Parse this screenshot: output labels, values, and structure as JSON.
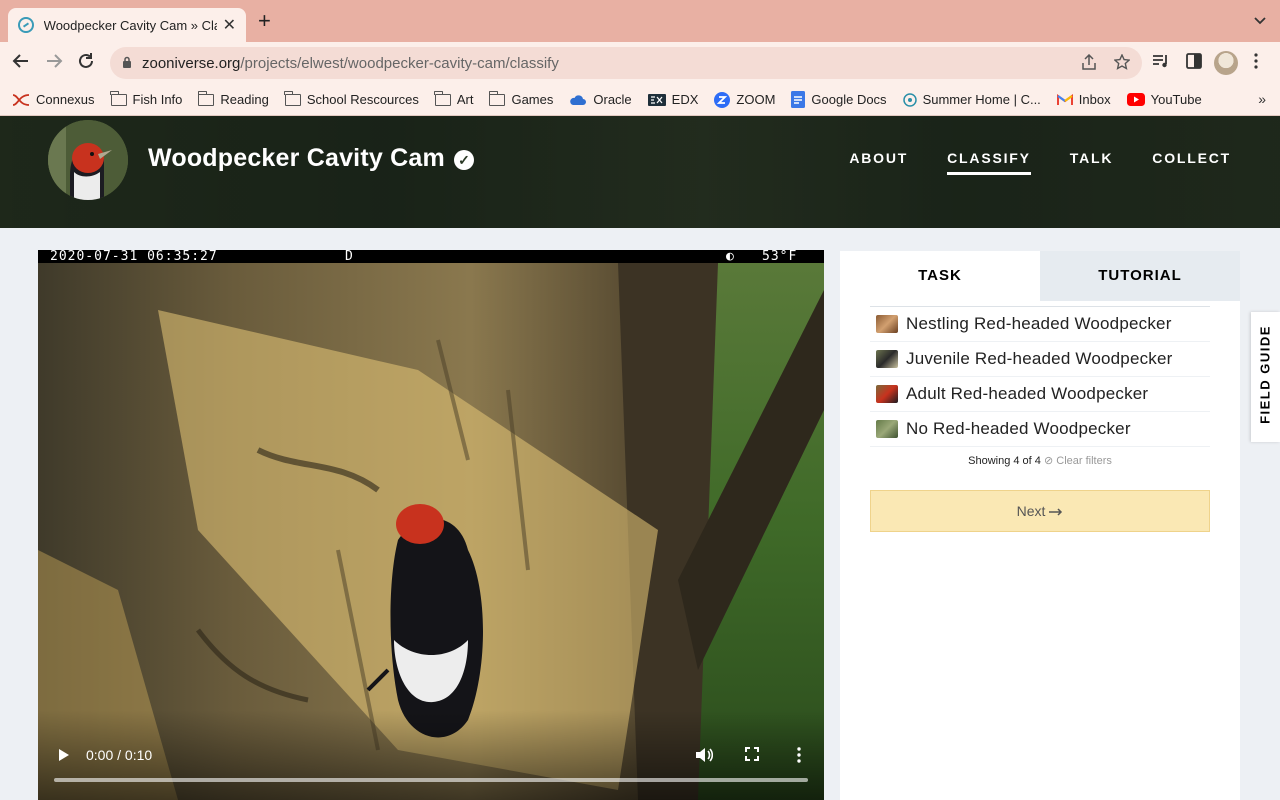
{
  "browser": {
    "tab_title": "Woodpecker Cavity Cam » Classify",
    "tab_close": "✕",
    "new_tab": "+",
    "url_host": "zooniverse.org",
    "url_path": "/projects/elwest/woodpecker-cavity-cam/classify",
    "bookmarks": [
      {
        "label": "Connexus",
        "icon": "connexus-logo"
      },
      {
        "label": "Fish Info",
        "icon": "folder-icon"
      },
      {
        "label": "Reading",
        "icon": "folder-icon"
      },
      {
        "label": "School Rescources",
        "icon": "folder-icon"
      },
      {
        "label": "Art",
        "icon": "folder-icon"
      },
      {
        "label": "Games",
        "icon": "folder-icon"
      },
      {
        "label": "Oracle",
        "icon": "cloud-icon"
      },
      {
        "label": "EDX",
        "icon": "edx-logo"
      },
      {
        "label": "ZOOM",
        "icon": "zoom-logo"
      },
      {
        "label": "Google Docs",
        "icon": "docs-icon"
      },
      {
        "label": "Summer Home | C...",
        "icon": "site-icon"
      },
      {
        "label": "Inbox",
        "icon": "gmail-icon"
      },
      {
        "label": "YouTube",
        "icon": "youtube-icon"
      }
    ],
    "bookmarks_more": "»"
  },
  "site": {
    "project_title": "Woodpecker Cavity Cam",
    "nav": [
      {
        "label": "ABOUT",
        "active": false
      },
      {
        "label": "CLASSIFY",
        "active": true
      },
      {
        "label": "TALK",
        "active": false
      },
      {
        "label": "COLLECT",
        "active": false
      }
    ]
  },
  "video": {
    "timestamp": "2020-07-31 06:35:27",
    "day_flag": "D",
    "moon_glyph": "◐",
    "temperature": "53°F",
    "time_display": "0:00 / 0:10"
  },
  "panel": {
    "tabs": [
      "TASK",
      "TUTORIAL"
    ],
    "answers": [
      {
        "label": "Nestling Red-headed Woodpecker",
        "thumb_color": "#8a5a32"
      },
      {
        "label": "Juvenile Red-headed Woodpecker",
        "thumb_color": "#6d7450"
      },
      {
        "label": "Adult Red-headed Woodpecker",
        "thumb_color": "#7a6a3a"
      },
      {
        "label": "No Red-headed Woodpecker",
        "thumb_color": "#647a48"
      }
    ],
    "showing": "Showing 4 of 4",
    "clear_filters": "Clear filters",
    "next_label": "Next",
    "field_guide": "FIELD GUIDE"
  },
  "colors": {
    "tabstrip": "#e8b0a3",
    "toolbar": "#fcefea",
    "next_button": "#fae8b4",
    "accent_red": "#c8321e"
  }
}
